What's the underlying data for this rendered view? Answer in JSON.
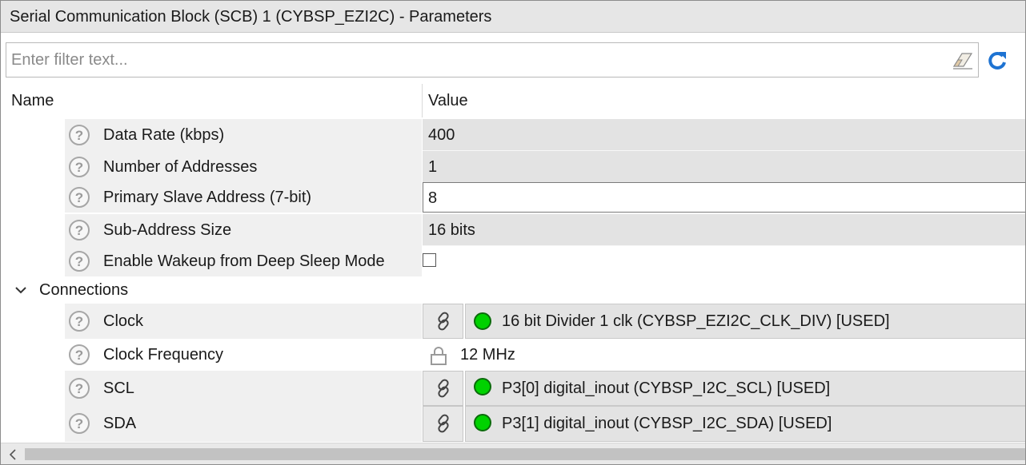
{
  "window": {
    "title": "Serial Communication Block (SCB) 1 (CYBSP_EZI2C) - Parameters"
  },
  "filter": {
    "placeholder": "Enter filter text...",
    "value": ""
  },
  "icons": {
    "clear_filter": "eraser-icon",
    "refresh": "refresh-icon",
    "help": "help-circle-icon",
    "link": "link-icon",
    "lock": "lock-icon",
    "expand": "chevron-down-icon"
  },
  "table": {
    "headers": {
      "name": "Name",
      "value": "Value"
    },
    "params": [
      {
        "label": "Data Rate (kbps)",
        "value": "400"
      },
      {
        "label": "Number of Addresses",
        "value": "1"
      },
      {
        "label": "Primary Slave Address (7-bit)",
        "value": "8"
      },
      {
        "label": "Sub-Address Size",
        "value": "16 bits"
      },
      {
        "label": "Enable Wakeup from Deep Sleep Mode",
        "checked": false
      }
    ],
    "connections": {
      "label": "Connections",
      "expanded": true,
      "items": [
        {
          "label": "Clock",
          "value": "16 bit Divider 1 clk (CYBSP_EZI2C_CLK_DIV) [USED]",
          "status_color": "#00d200"
        },
        {
          "label": "Clock Frequency",
          "value": "12 MHz",
          "locked": true
        },
        {
          "label": "SCL",
          "value": "P3[0] digital_inout (CYBSP_I2C_SCL) [USED]",
          "status_color": "#00d200"
        },
        {
          "label": "SDA",
          "value": "P3[1] digital_inout (CYBSP_I2C_SDA) [USED]",
          "status_color": "#00d200"
        }
      ]
    }
  },
  "colors": {
    "accent": "#1e73d2",
    "status_ok": "#00d200",
    "header_bg": "#e6e6e6",
    "value_bg": "#e3e3e3"
  }
}
